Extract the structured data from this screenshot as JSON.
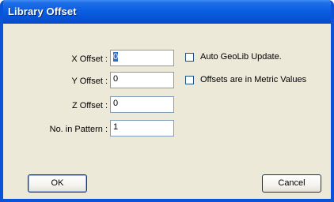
{
  "window": {
    "title": "Library Offset"
  },
  "fields": {
    "x_offset": {
      "label": "X Offset :",
      "value": "0"
    },
    "y_offset": {
      "label": "Y Offset :",
      "value": "0"
    },
    "z_offset": {
      "label": "Z Offset :",
      "value": "0"
    },
    "pattern": {
      "label": "No. in Pattern :",
      "value": "1"
    }
  },
  "options": {
    "auto_geolib": {
      "label": "Auto GeoLib Update.",
      "checked": false
    },
    "metric": {
      "label": "Offsets are in Metric Values",
      "checked": false
    }
  },
  "buttons": {
    "ok": "OK",
    "cancel": "Cancel"
  }
}
